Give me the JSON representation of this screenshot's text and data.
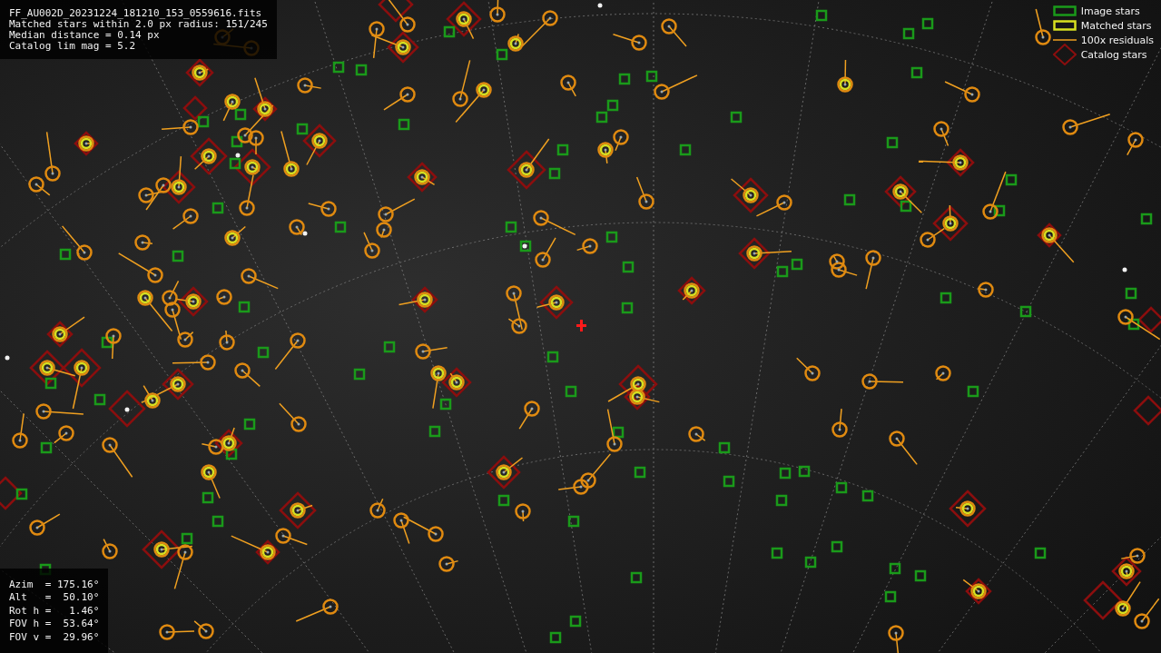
{
  "file_info": {
    "lines": [
      "FF_AU002D_20231224_181210_153_0559616.fits",
      "Matched stars within 2.0 px radius: 151/245",
      "Median distance = 0.14 px",
      "Catalog lim mag = 5.2"
    ]
  },
  "legend": [
    {
      "label": "Image stars",
      "kind": "image"
    },
    {
      "label": "Matched stars",
      "kind": "matched"
    },
    {
      "label": "100x residuals",
      "kind": "residual"
    },
    {
      "label": "Catalog stars",
      "kind": "catalog"
    }
  ],
  "pointing": {
    "lines": [
      "Azim  = 175.16°",
      "Alt   =  50.10°",
      "Rot h =   1.46°",
      "FOV h =  53.64°",
      "FOV v =  29.96°"
    ]
  }
}
